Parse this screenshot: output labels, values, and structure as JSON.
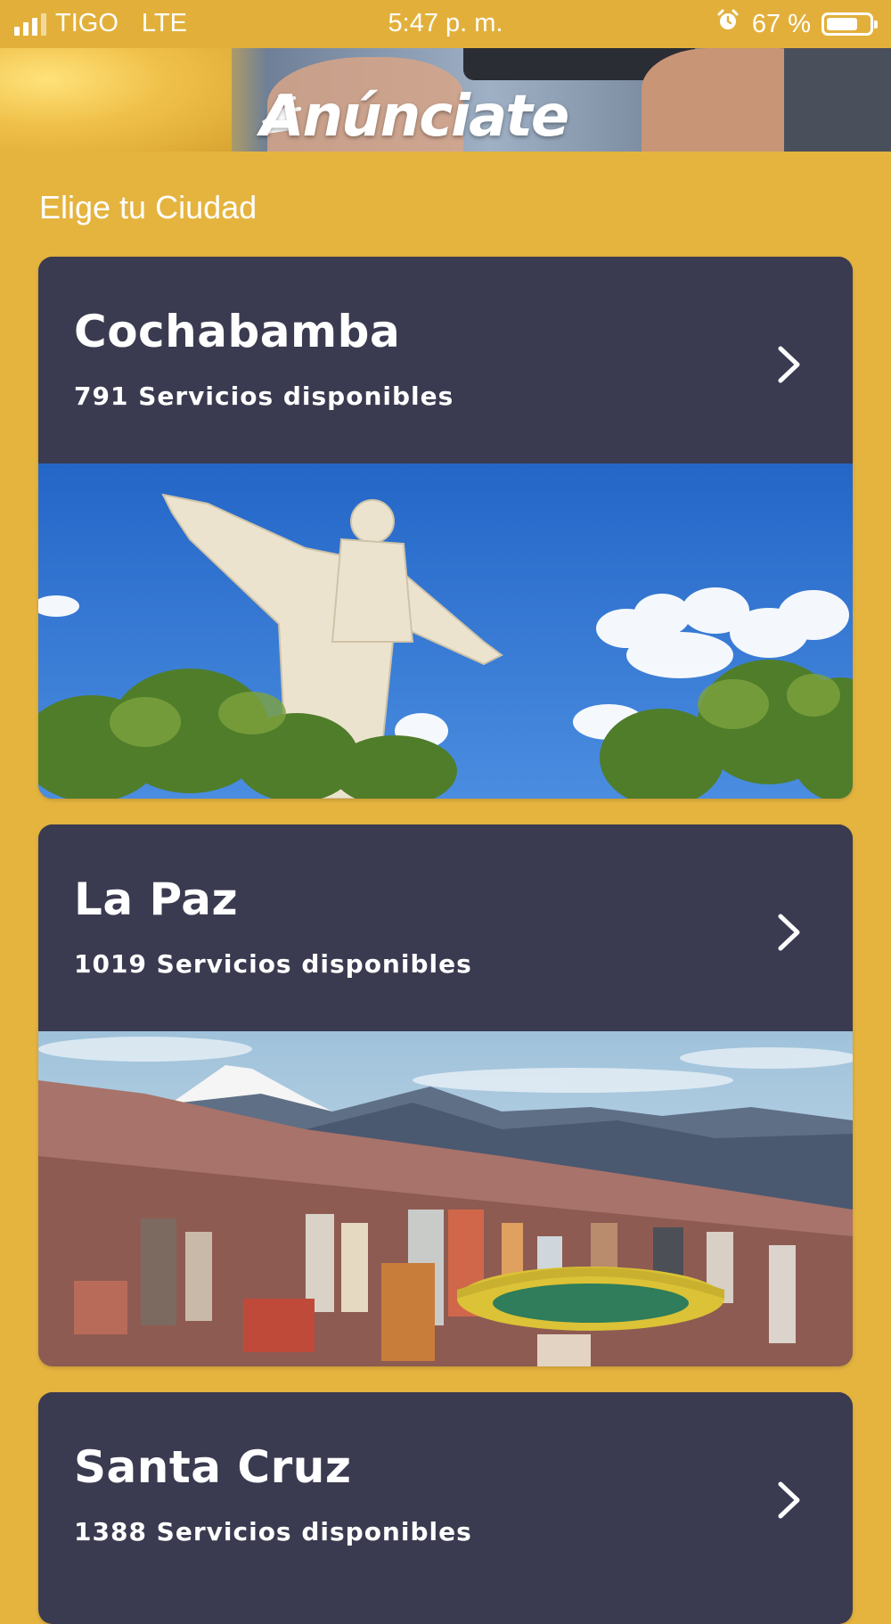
{
  "status_bar": {
    "carrier": "TIGO",
    "network": "LTE",
    "time": "5:47 p. m.",
    "battery": "67 %",
    "icons": [
      "signal-icon",
      "alarm-icon",
      "battery-icon"
    ]
  },
  "banner": {
    "text": "Anúnciate",
    "icon": "megaphone-icon"
  },
  "section_title": "Elige tu Ciudad",
  "cities": [
    {
      "name": "Cochabamba",
      "count": "791 Servicios disponibles",
      "icon": "chevron-right-icon"
    },
    {
      "name": "La Paz",
      "count": "1019 Servicios disponibles",
      "icon": "chevron-right-icon"
    },
    {
      "name": "Santa Cruz",
      "count": "1388 Servicios disponibles",
      "icon": "chevron-right-icon"
    }
  ],
  "colors": {
    "background": "#e5b43f",
    "card": "#3a3a50",
    "text": "#ffffff"
  }
}
